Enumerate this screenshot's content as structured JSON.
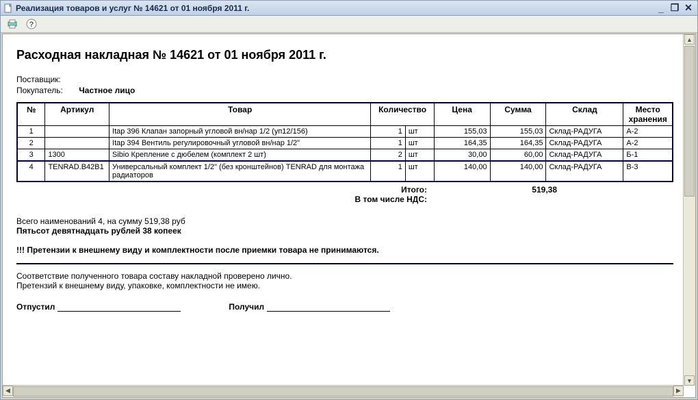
{
  "window": {
    "title": "Реализация товаров и услуг № 14621 от 01 ноября 2011 г."
  },
  "doc": {
    "heading": "Расходная накладная № 14621 от 01 ноября 2011 г.",
    "supplier_label": "Поставщик:",
    "supplier_value": "",
    "buyer_label": "Покупатель:",
    "buyer_value": "Частное лицо"
  },
  "table": {
    "headers": {
      "n": "№",
      "article": "Артикул",
      "product": "Товар",
      "qty": "Количество",
      "price": "Цена",
      "sum": "Сумма",
      "warehouse": "Склад",
      "location": "Место хранения"
    },
    "rows": [
      {
        "n": "1",
        "article": "",
        "product": "Itap 396 Клапан запорный угловой вн/нар 1/2 (уп12/156)",
        "qty": "1",
        "unit": "шт",
        "price": "155,03",
        "sum": "155,03",
        "warehouse": "Склад-РАДУГА",
        "location": "А-2"
      },
      {
        "n": "2",
        "article": "",
        "product": "Itap 394 Вентиль регулировочный угловой вн/нар 1/2\"",
        "qty": "1",
        "unit": "шт",
        "price": "164,35",
        "sum": "164,35",
        "warehouse": "Склад-РАДУГА",
        "location": "А-2"
      },
      {
        "n": "3",
        "article": "1300",
        "product": "Sibio Крепление с дюбелем  (комплект 2 шт)",
        "qty": "2",
        "unit": "шт",
        "price": "30,00",
        "sum": "60,00",
        "warehouse": "Склад-РАДУГА",
        "location": "Б-1"
      },
      {
        "n": "4",
        "article": "TENRAD.B42B1",
        "product": "Универсальный комплект 1/2\" (без кронштейнов) TENRAD для монтажа радиаторов",
        "qty": "1",
        "unit": "шт",
        "price": "140,00",
        "sum": "140,00",
        "warehouse": "Склад-РАДУГА",
        "location": "В-3"
      }
    ]
  },
  "totals": {
    "total_label": "Итого:",
    "total_value": "519,38",
    "vat_label": "В том числе НДС:",
    "vat_value": ""
  },
  "notes": {
    "count_sum": "Всего наименований 4, на сумму 519,38 руб",
    "sum_words": "Пятьсот девятнадцать рублей 38 копеек",
    "warning": "!!! Претензии к внешнему виду и комплектности после приемки товара не принимаются.",
    "confirm_line1": "Соответствие полученного товара составу накладной проверено лично.",
    "confirm_line2": "Претензий к внешнему виду, упаковке, комплектности не имею."
  },
  "signatures": {
    "released": "Отпустил",
    "received": "Получил"
  }
}
